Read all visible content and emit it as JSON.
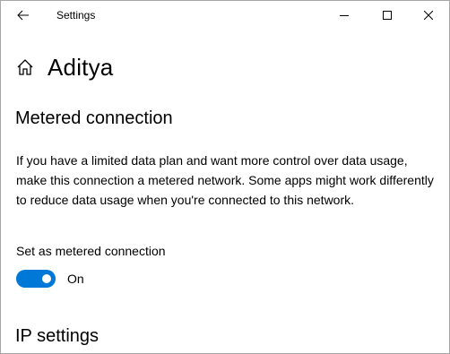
{
  "window": {
    "title": "Settings"
  },
  "header": {
    "title": "Aditya",
    "icon": "home-icon"
  },
  "metered": {
    "section_title": "Metered connection",
    "description": "If you have a limited data plan and want more control over data usage, make this connection a metered network. Some apps might work differently to reduce data usage when you're connected to this network.",
    "toggle_label": "Set as metered connection",
    "toggle_state": "On",
    "toggle_on": true
  },
  "ip": {
    "section_title": "IP settings"
  },
  "colors": {
    "accent": "#0078d7"
  }
}
